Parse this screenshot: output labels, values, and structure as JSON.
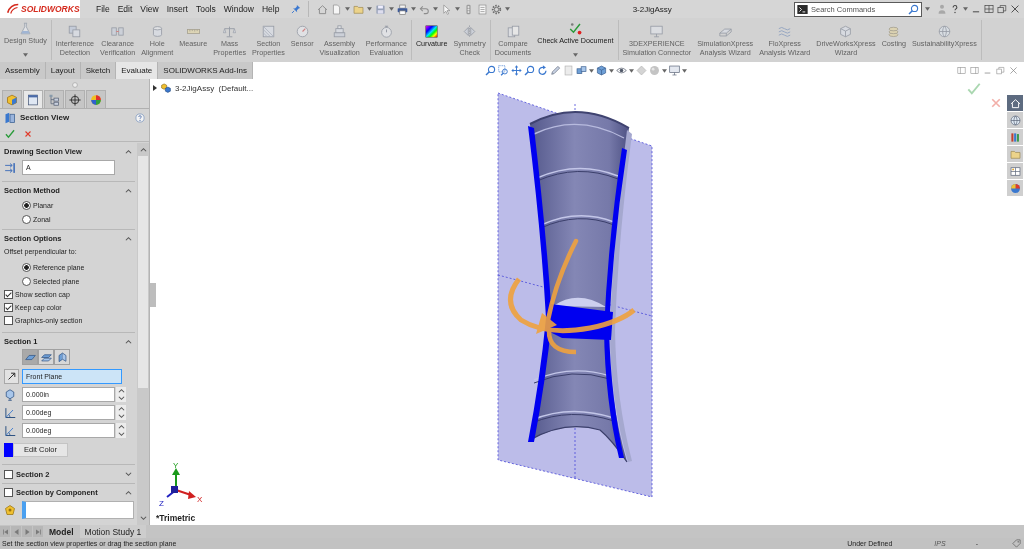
{
  "title_bar": {
    "logo": "SOLIDWORKS",
    "menu": [
      "File",
      "Edit",
      "View",
      "Insert",
      "Tools",
      "Window",
      "Help"
    ],
    "document_title": "3-2JigAssy",
    "search": {
      "placeholder": "Search Commands"
    }
  },
  "ribbon": {
    "groups": [
      {
        "buttons": [
          {
            "label": "Design Study",
            "disabled": true,
            "dropdown": true
          }
        ]
      },
      {
        "buttons": [
          {
            "label": "Interference\nDetection",
            "disabled": true,
            "dropdown": false
          },
          {
            "label": "Clearance\nVerification",
            "disabled": true,
            "dropdown": false
          },
          {
            "label": "Hole\nAlignment",
            "disabled": true,
            "dropdown": false
          },
          {
            "label": "Measure",
            "disabled": true,
            "dropdown": false
          },
          {
            "label": "Mass\nProperties",
            "disabled": true,
            "dropdown": false
          },
          {
            "label": "Section\nProperties",
            "disabled": true,
            "dropdown": false
          },
          {
            "label": "Sensor",
            "disabled": true,
            "dropdown": false
          },
          {
            "label": "Assembly\nVisualization",
            "disabled": true,
            "dropdown": false
          },
          {
            "label": "Performance\nEvaluation",
            "disabled": true,
            "dropdown": false
          }
        ]
      },
      {
        "buttons": [
          {
            "label": "Curvature",
            "disabled": false,
            "dropdown": false
          },
          {
            "label": "Symmetry\nCheck",
            "disabled": true,
            "dropdown": false
          }
        ]
      },
      {
        "buttons": [
          {
            "label": "Compare\nDocuments",
            "disabled": true,
            "dropdown": false
          },
          {
            "label": "Check Active Document",
            "disabled": false,
            "dropdown": true
          }
        ]
      },
      {
        "buttons": [
          {
            "label": "3DEXPERIENCE\nSimulation Connector",
            "disabled": true,
            "dropdown": false
          },
          {
            "label": "SimulationXpress\nAnalysis Wizard",
            "disabled": true,
            "dropdown": false
          },
          {
            "label": "FloXpress\nAnalysis Wizard",
            "disabled": true,
            "dropdown": false
          },
          {
            "label": "DriveWorksXpress\nWizard",
            "disabled": true,
            "dropdown": false
          },
          {
            "label": "Costing",
            "disabled": true,
            "dropdown": false
          },
          {
            "label": "SustainabilityXpress",
            "disabled": true,
            "dropdown": false
          }
        ]
      }
    ]
  },
  "command_tabs": [
    {
      "label": "Assembly",
      "selected": false
    },
    {
      "label": "Layout",
      "selected": false
    },
    {
      "label": "Sketch",
      "selected": false
    },
    {
      "label": "Evaluate",
      "selected": true
    },
    {
      "label": "SOLIDWORKS Add-Ins",
      "selected": false
    }
  ],
  "manager_tabs": [
    {
      "selected": false
    },
    {
      "selected": true
    },
    {
      "selected": false
    },
    {
      "selected": false
    },
    {
      "selected": false
    }
  ],
  "property_manager": {
    "title": "Section View",
    "drawing_section_view": {
      "title": "Drawing Section View",
      "expanded": true,
      "label": "A"
    },
    "section_method": {
      "title": "Section Method",
      "expanded": true,
      "options": [
        {
          "label": "Planar",
          "selected": true
        },
        {
          "label": "Zonal",
          "selected": false
        }
      ]
    },
    "section_options": {
      "title": "Section Options",
      "expanded": true,
      "prompt": "Offset perpendicular to:",
      "options": [
        {
          "label": "Reference plane",
          "selected": true
        },
        {
          "label": "Selected plane",
          "selected": false
        }
      ],
      "checkboxes": [
        {
          "label": "Show section cap",
          "checked": true
        },
        {
          "label": "Keep cap color",
          "checked": true
        },
        {
          "label": "Graphics-only section",
          "checked": false
        }
      ]
    },
    "section_1": {
      "title": "Section 1",
      "expanded": true,
      "modes": [
        {
          "selected": true
        },
        {
          "selected": false
        },
        {
          "selected": false
        }
      ],
      "reference": "Front Plane",
      "offset": "0.000in",
      "angles": [
        "0.00deg",
        "0.00deg"
      ],
      "color_button": "Edit Color"
    },
    "section_2": {
      "title": "Section 2",
      "checked": false,
      "expanded": false
    },
    "section_by_component": {
      "title": "Section by Component",
      "checked": false,
      "expanded": true
    }
  },
  "viewport": {
    "tree": {
      "label": "3-2JigAssy  (Default...",
      "expanded": false
    },
    "triad_axes": [
      "Y",
      "X",
      "Z"
    ],
    "view_name": "*Trimetric"
  },
  "task_pane": [
    {
      "selected": true
    },
    {
      "selected": false
    },
    {
      "selected": false
    },
    {
      "selected": false
    },
    {
      "selected": false
    },
    {
      "selected": false
    }
  ],
  "bottom_tabs": [
    {
      "label": "Model",
      "selected": true
    },
    {
      "label": "Motion Study 1",
      "selected": false
    }
  ],
  "status_bar": {
    "message": "Set the section view properties or drag the section plane",
    "state": "Under Defined",
    "units": {
      "text": "IPS",
      "disabled": true
    },
    "field_4": "-"
  }
}
